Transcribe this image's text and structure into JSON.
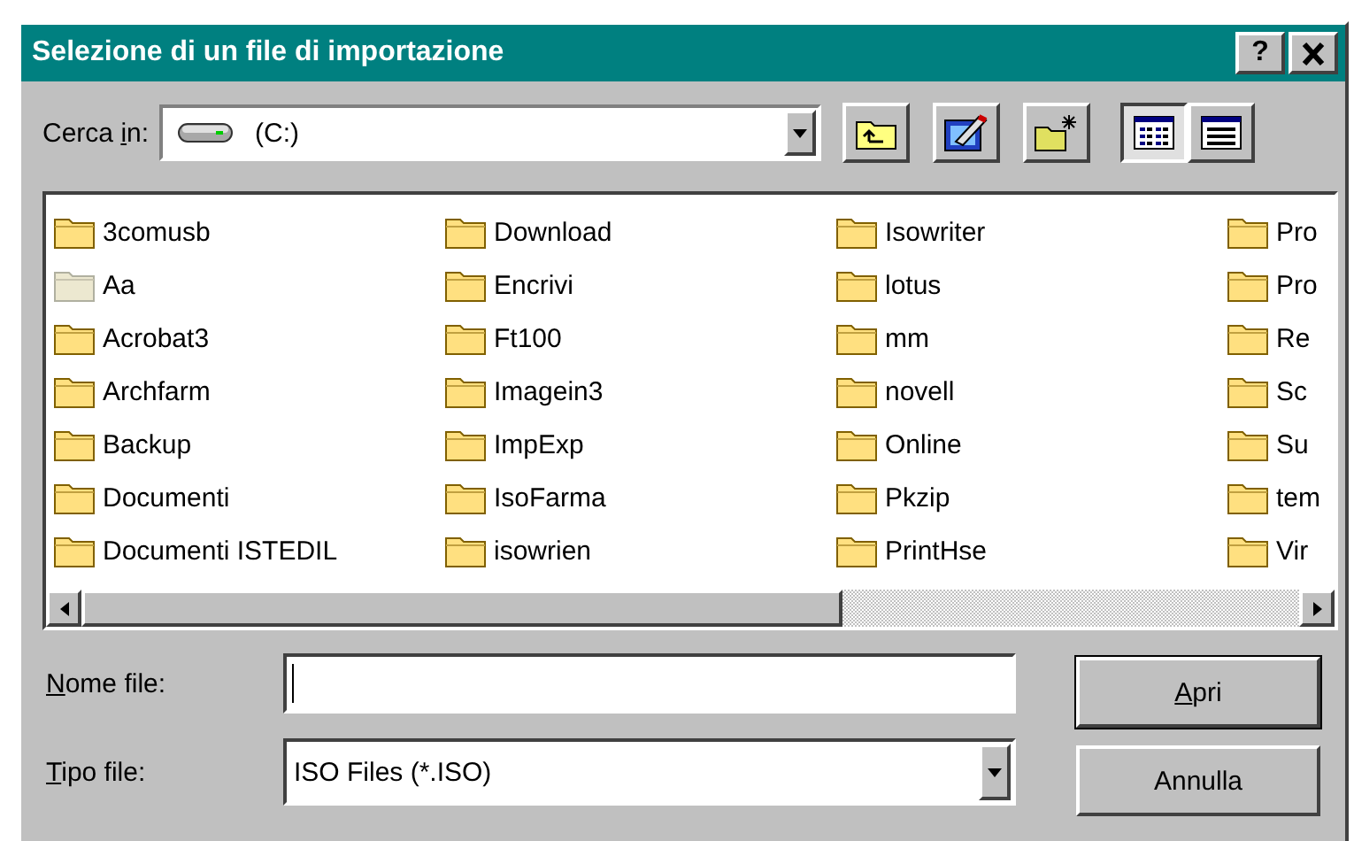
{
  "window": {
    "title": "Selezione di un file di importazione",
    "controls": [
      {
        "kind": "help",
        "label": "?"
      },
      {
        "kind": "close"
      }
    ]
  },
  "look_in": {
    "label_start": "Cerca ",
    "mnemonic": "i",
    "label_rest": "n:",
    "value": "(C:)"
  },
  "toolbar": [
    {
      "kind": "up",
      "selected": false
    },
    {
      "kind": "desktop",
      "selected": false
    },
    {
      "kind": "new-folder",
      "selected": false
    },
    {
      "kind": "list",
      "selected": true
    },
    {
      "kind": "details",
      "selected": false
    }
  ],
  "files": [
    {
      "name": "3comusb",
      "hidden": false
    },
    {
      "name": "Aa",
      "hidden": true
    },
    {
      "name": "Acrobat3",
      "hidden": false
    },
    {
      "name": "Archfarm",
      "hidden": false
    },
    {
      "name": "Backup",
      "hidden": false
    },
    {
      "name": "Documenti",
      "hidden": false
    },
    {
      "name": "Documenti ISTEDIL",
      "hidden": false
    },
    {
      "name": "Download",
      "hidden": false
    },
    {
      "name": "Encrivi",
      "hidden": false
    },
    {
      "name": "Ft100",
      "hidden": false
    },
    {
      "name": "Imagein3",
      "hidden": false
    },
    {
      "name": "ImpExp",
      "hidden": false
    },
    {
      "name": "IsoFarma",
      "hidden": false
    },
    {
      "name": "isowrien",
      "hidden": false
    },
    {
      "name": "Isowriter",
      "hidden": false
    },
    {
      "name": "lotus",
      "hidden": false
    },
    {
      "name": "mm",
      "hidden": false
    },
    {
      "name": "novell",
      "hidden": false
    },
    {
      "name": "Online",
      "hidden": false
    },
    {
      "name": "Pkzip",
      "hidden": false
    },
    {
      "name": "PrintHse",
      "hidden": false
    },
    {
      "name": "Pro",
      "hidden": false
    },
    {
      "name": "Pro",
      "hidden": false
    },
    {
      "name": "Re",
      "hidden": false
    },
    {
      "name": "Sc",
      "hidden": false
    },
    {
      "name": "Su",
      "hidden": false
    },
    {
      "name": "tem",
      "hidden": false
    },
    {
      "name": "Vir",
      "hidden": false
    }
  ],
  "file_name": {
    "mnemonic": "N",
    "label_rest": "ome file:"
  },
  "file_type": {
    "mnemonic": "T",
    "label_rest": "ipo file:",
    "value": "ISO Files (*.ISO)"
  },
  "actions": [
    {
      "mnemonic": "A",
      "label_rest": "pri",
      "default": true
    },
    {
      "label_rest": "Annulla",
      "default": false
    }
  ]
}
